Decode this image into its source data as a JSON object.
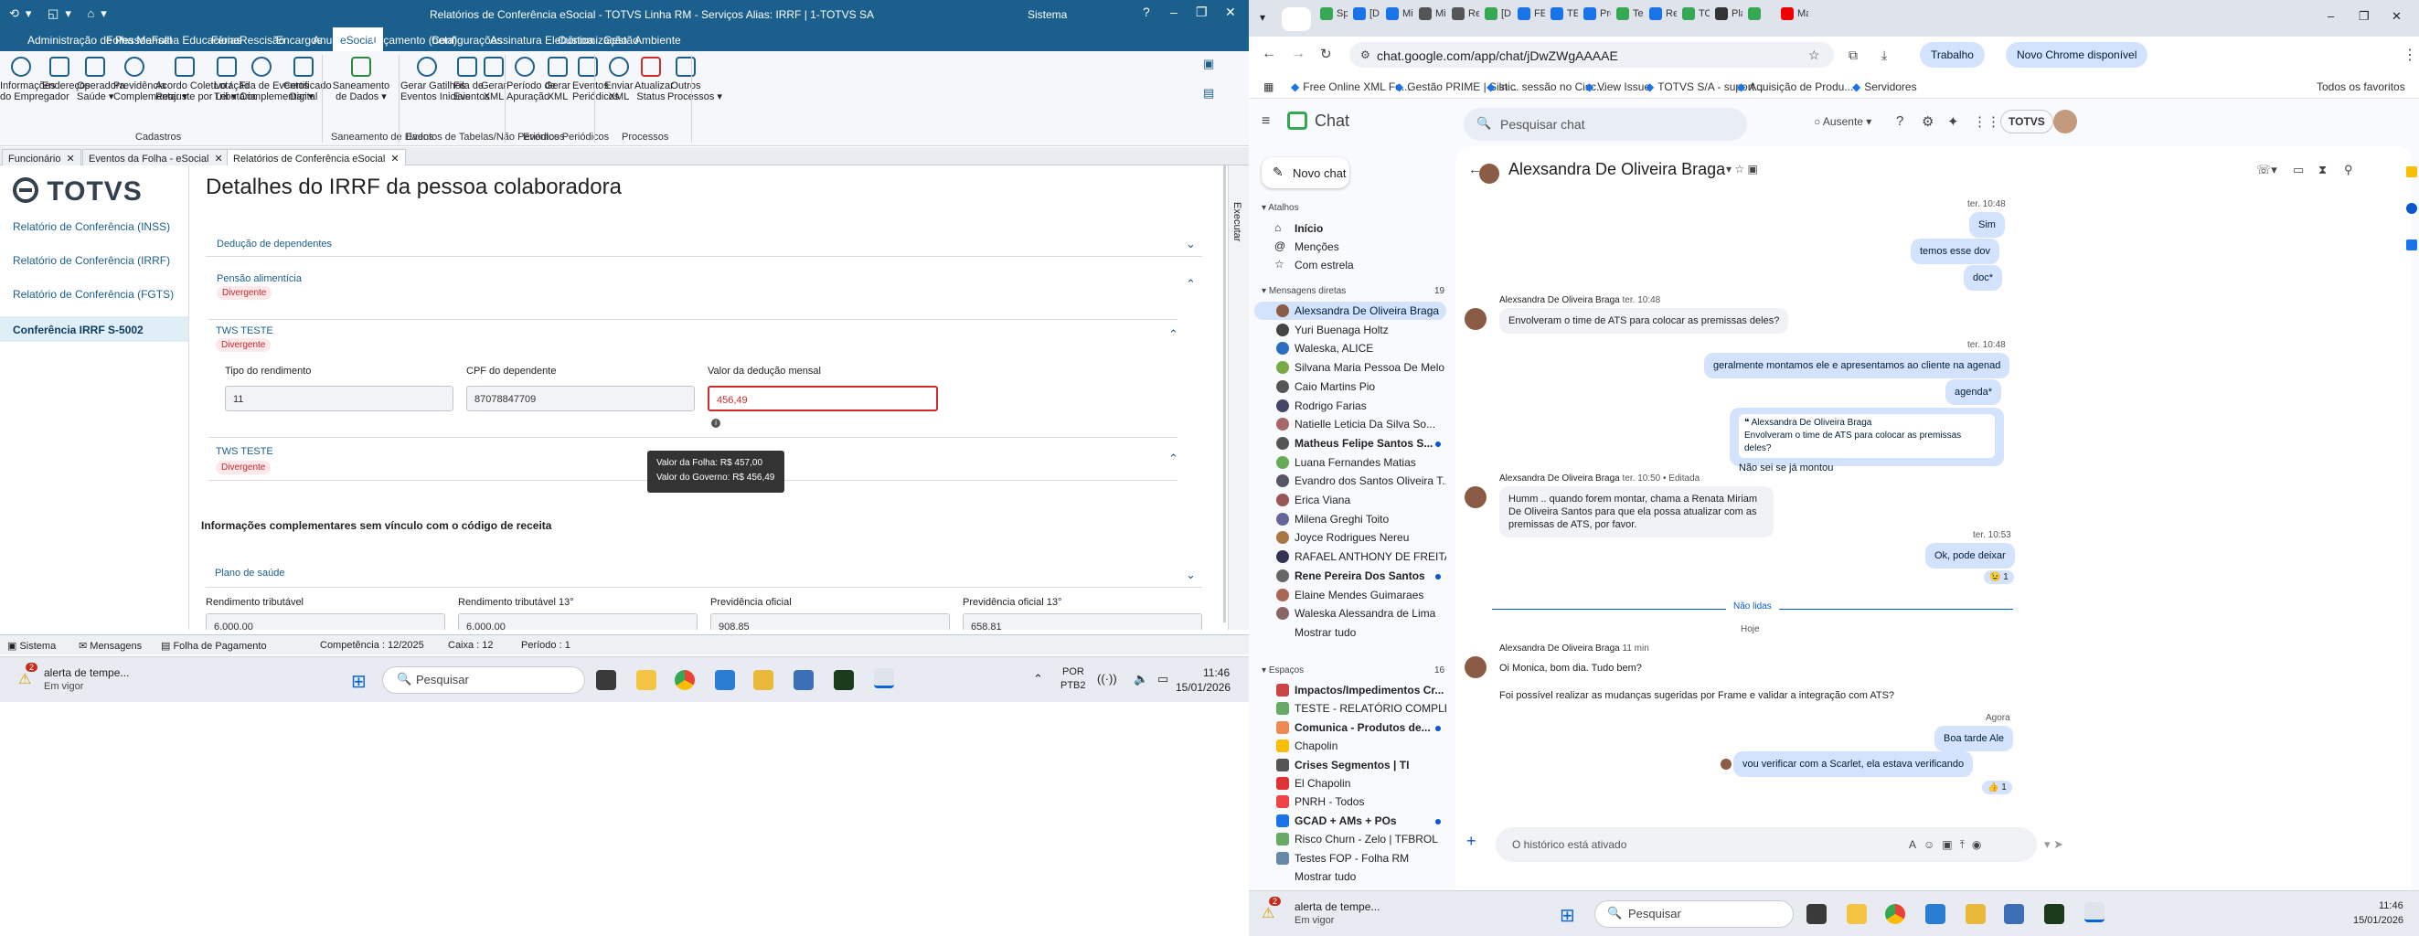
{
  "left_app": {
    "title": "Relatórios de Conferência eSocial - TOTVS Linha RM - Serviços  Alias: IRRF | 1-TOTVS SA",
    "system_label": "Sistema",
    "menu": [
      "Administração de Pessoal",
      "Folha Mensal",
      "Folha Educacional",
      "Férias",
      "Rescisão",
      "Encargos",
      "Anuais",
      "eSocial",
      "Orçamento (beta)",
      "Configurações",
      "Assinatura Eletrônica",
      "Customização",
      "Gestão",
      "Ambiente"
    ],
    "ribbon": [
      {
        "label": "Informações\ndo Empregador"
      },
      {
        "label": "Endereços\n"
      },
      {
        "label": "Operadora\nSaúde ▾"
      },
      {
        "label": "Previdência\nComplementar ▾"
      },
      {
        "label": "Acordo Coletivo /\nReajuste por Lei ▾"
      },
      {
        "label": "Lotação\nTributária"
      },
      {
        "label": "Fila de Eventos\nComplementar ▾"
      },
      {
        "label": "Certificado\nDigital"
      },
      {
        "label": "Saneamento\nde Dados ▾"
      },
      {
        "label": "Gerar Gatilhos\nEventos Iniciais"
      },
      {
        "label": "Fila de\nEventos"
      },
      {
        "label": "Gerar\nXML"
      },
      {
        "label": "Período de\nApuração"
      },
      {
        "label": "Gerar\nXML"
      },
      {
        "label": "Eventos\nPeriódicos"
      },
      {
        "label": "Enviar\nXML"
      },
      {
        "label": "Atualizar\nStatus"
      },
      {
        "label": "Outros\nProcessos ▾"
      }
    ],
    "groups": [
      "Cadastros",
      "Saneamento de Dados",
      "Eventos de Tabelas/Não Periódicos",
      "Eventos Periódicos",
      "Processos"
    ],
    "tabs": [
      "Funcionário",
      "Eventos da Folha - eSocial",
      "Relatórios de Conferência eSocial"
    ],
    "nav_logo": "TOTVS",
    "nav": [
      "Relatório de Conferência (INSS)",
      "Relatório de Conferência (IRRF)",
      "Relatório de Conferência (FGTS)",
      "Conferência IRRF S-5002"
    ],
    "side_label": "Executar",
    "page_title": "Detalhes do IRRF da pessoa colaboradora",
    "sections": {
      "deducao": "Dedução de dependentes",
      "pensao": "Pensão alimentícia",
      "divergente": "Divergente",
      "tws": "TWS TESTE",
      "f_tipo": "Tipo do rendimento",
      "f_cpf": "CPF do dependente",
      "f_valor": "Valor da dedução mensal",
      "v_tipo": "11",
      "v_cpf": "87078847709",
      "v_valor": "456,49",
      "tip1": "Valor da Folha: R$ 457,00",
      "tip2": "Valor do Governo: R$ 456,49",
      "info": "Informações complementares sem vínculo com o código de receita",
      "plano": "Plano de saúde",
      "r1": "Rendimento tributável",
      "r2": "Rendimento tributável 13°",
      "r3": "Previdência oficial",
      "r4": "Previdência oficial 13°",
      "rv1": "6.000,00",
      "rv2": "6.000,00",
      "rv3": "908,85",
      "rv4": "658,81"
    },
    "status": {
      "s1": "Sistema",
      "s2": "Mensagens",
      "s3": "Folha de Pagamento",
      "comp": "Competência : 12/2025",
      "caixa": "Caixa : 12",
      "periodo": "Período : 1"
    }
  },
  "taskbar_left": {
    "alert_title": "alerta de tempe...",
    "alert_sub": "Em vigor",
    "badge": "2",
    "search": "Pesquisar",
    "lang1": "POR",
    "lang2": "PTB2",
    "time": "11:46",
    "date": "15/01/2026"
  },
  "browser": {
    "tabs": [
      "Sp",
      "[D",
      "Mi",
      "Mi",
      "Re",
      "[D",
      "FE",
      "TE",
      "Pro",
      "Ter",
      "Rel",
      "TO",
      "Pla",
      "",
      "Ma"
    ],
    "url": "chat.google.com/app/chat/jDwZWgAAAAE",
    "profile": "Trabalho",
    "new_chrome": "Novo Chrome disponível",
    "bookmarks": [
      "Free Online XML Fo...",
      "Gestão PRIME | Sist...",
      "Inic. sessão no Cisc...",
      "View Issue",
      "TOTVS S/A - suport...",
      "Aquisição de Produ...",
      "Servidores"
    ],
    "all_bookmarks": "Todos os favoritos"
  },
  "chat": {
    "app": "Chat",
    "search": "Pesquisar chat",
    "status": "Ausente",
    "brand": "TOTVS",
    "new_chat": "Novo chat",
    "atalhos": "Atalhos",
    "shortcuts": [
      "Início",
      "Menções",
      "Com estrela"
    ],
    "dm_header": "Mensagens diretas",
    "dm_count": "19",
    "dms": [
      "Alexsandra De Oliveira Braga",
      "Yuri Buenaga Holtz",
      "Waleska, ALICE",
      "Silvana Maria Pessoa De Melo",
      "Caio Martins Pio",
      "Rodrigo Farias",
      "Natielle Leticia Da Silva So...",
      "Matheus Felipe Santos S...",
      "Luana Fernandes Matias",
      "Evandro dos Santos Oliveira T...",
      "Erica Viana",
      "Milena Greghi Toito",
      "Joyce Rodrigues Nereu",
      "RAFAEL ANTHONY DE FREITAS",
      "Rene Pereira Dos Santos",
      "Elaine Mendes Guimaraes",
      "Waleska Alessandra de Lima"
    ],
    "show_all": "Mostrar tudo",
    "spaces_header": "Espaços",
    "spaces_count": "16",
    "spaces": [
      "Impactos/Impedimentos Cr...",
      "TESTE - RELATÓRIO COMPLE...",
      "Comunica - Produtos de...",
      "Chapolin",
      "Crises Segmentos | TI",
      "El Chapolin",
      "PNRH - Todos",
      "GCAD + AMs + POs",
      "Risco Churn - Zelo | TFBROL",
      "Testes FOP - Folha RM"
    ],
    "show_all2": "Mostrar tudo",
    "conv_name": "Alexsandra De Oliveira Braga",
    "msgs": {
      "t1": "ter. 10:48",
      "o1": "Sim",
      "o2": "temos esse dov",
      "o3": "doc*",
      "s1": "Alexsandra De Oliveira Braga",
      "t2": "ter. 10:48",
      "i1": "Envolveram o time de ATS para colocar as premissas deles?",
      "t3": "ter. 10:48",
      "o4": "geralmente montamos ele e apresentamos ao cliente na agenad",
      "o5": "agenda*",
      "q_name": "Alexsandra De Oliveira Braga",
      "q_text": "Envolveram o time de ATS para colocar as premissas deles?",
      "q_reply": "Não sei se já montou",
      "s2": "Alexsandra De Oliveira Braga",
      "t4": "ter. 10:50 • Editada",
      "i2": "Humm .. quando forem montar, chama a Renata Miriam De Oliveira Santos para que ela possa atualizar com as premissas de ATS, por favor.",
      "t5": "ter. 10:53",
      "o6": "Ok, pode deixar",
      "r1": "😉 1",
      "unread": "Não lidas",
      "today": "Hoje",
      "s3": "Alexsandra De Oliveira Braga",
      "t6": "11 min",
      "i3": "Oi Monica, bom dia. Tudo bem?",
      "i4": "Foi possível realizar as mudanças sugeridas por Frame e validar a integração com ATS?",
      "t7": "Agora",
      "o7": "Boa tarde Ale",
      "o8": "vou verificar com a Scarlet, ela estava verificando",
      "r2": "👍 1"
    },
    "composer": "O histórico está ativado"
  },
  "taskbar_right": {
    "alert_title": "alerta de tempe...",
    "alert_sub": "Em vigor",
    "badge": "2",
    "search": "Pesquisar",
    "time": "11:46",
    "date": "15/01/2026"
  }
}
